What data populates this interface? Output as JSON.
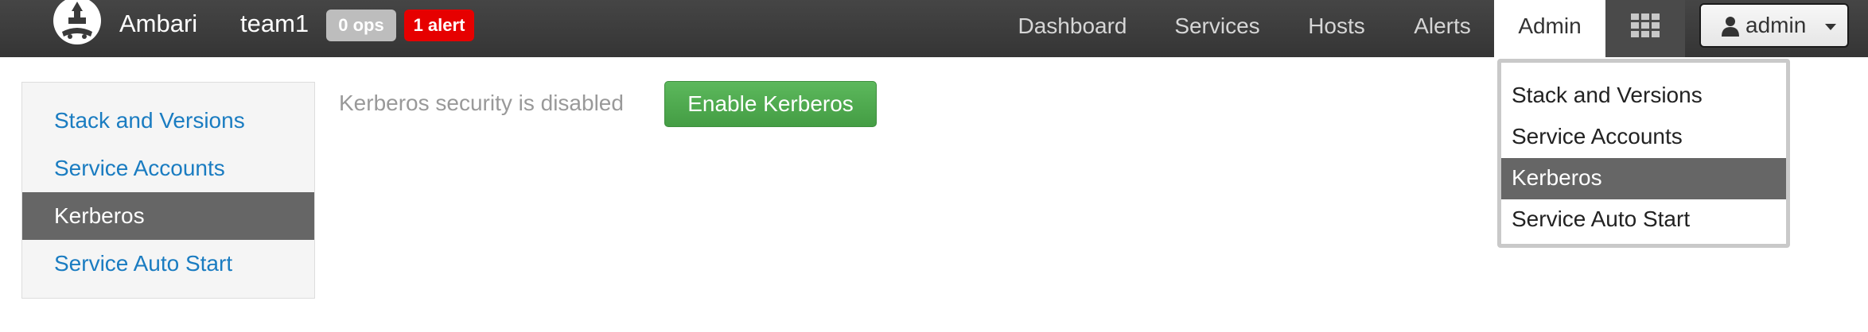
{
  "header": {
    "brand": "Ambari",
    "cluster_name": "team1",
    "ops_badge": "0 ops",
    "alert_badge": "1 alert",
    "nav": [
      {
        "label": "Dashboard"
      },
      {
        "label": "Services"
      },
      {
        "label": "Hosts"
      },
      {
        "label": "Alerts"
      },
      {
        "label": "Admin"
      }
    ],
    "user_menu_label": "admin"
  },
  "admin_dropdown": {
    "items": [
      {
        "label": "Stack and Versions"
      },
      {
        "label": "Service Accounts"
      },
      {
        "label": "Kerberos"
      },
      {
        "label": "Service Auto Start"
      }
    ]
  },
  "sidebar": {
    "items": [
      {
        "label": "Stack and Versions"
      },
      {
        "label": "Service Accounts"
      },
      {
        "label": "Kerberos"
      },
      {
        "label": "Service Auto Start"
      }
    ]
  },
  "main": {
    "status_text": "Kerberos security is disabled",
    "enable_button_label": "Enable Kerberos"
  },
  "colors": {
    "topbar": "#3a3a3a",
    "link": "#1a7cc1",
    "selected": "#666666",
    "success": "#5cb85c",
    "alert": "#e60000"
  }
}
